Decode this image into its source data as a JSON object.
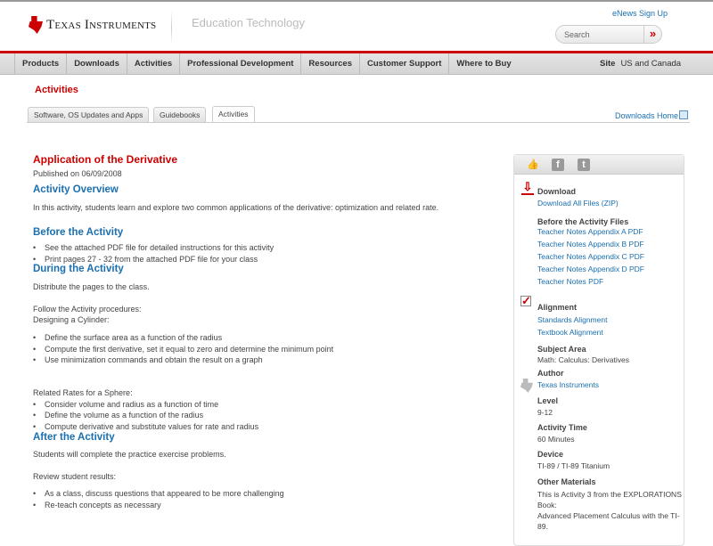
{
  "header": {
    "brand": "Texas Instruments",
    "section": "Education Technology",
    "enews": "eNews Sign Up",
    "search_placeholder": "Search",
    "search_go": "»"
  },
  "nav": {
    "items": [
      "Products",
      "Downloads",
      "Activities",
      "Professional Development",
      "Resources",
      "Customer Support",
      "Where to Buy"
    ],
    "site_label": "Site",
    "site_value": "US and Canada"
  },
  "page_heading": "Activities",
  "tabs": [
    "Software, OS Updates and Apps",
    "Guidebooks",
    "Activities"
  ],
  "downloads_home": "Downloads Home",
  "article": {
    "title": "Application of the Derivative",
    "published": "Published on 06/09/2008",
    "overview_h": "Activity Overview",
    "overview": "In this activity, students learn and explore two common applications of the derivative: optimization and related rate.",
    "before_h": "Before the Activity",
    "before": [
      "See the attached PDF file for detailed instructions for this activity",
      "Print pages 27 - 32 from the attached PDF file for your class"
    ],
    "during_h": "During the Activity",
    "during_p1": "Distribute the pages to the class.",
    "during_p2": "Follow the Activity procedures:",
    "during_p3": "Designing a Cylinder:",
    "during_list1": [
      "Define the surface area as a function of the radius",
      "Compute the first derivative, set it equal to zero and determine the minimum point",
      "Use minimization commands and obtain the result on a graph"
    ],
    "during_p4": "Related Rates for a Sphere:",
    "during_list2": [
      "Consider volume and radius as a function of time",
      "Define the volume as a function of the radius",
      "Compute derivative and substitute values for rate and radius"
    ],
    "after_h": "After the Activity",
    "after_p1": "Students will complete the practice exercise problems.",
    "after_p2": "Review student results:",
    "after_list": [
      "As a class, discuss questions that appeared to be more challenging",
      "Re-teach concepts as necessary"
    ]
  },
  "sidebar": {
    "download_h": "Download",
    "download_all": "Download All Files (ZIP)",
    "before_files_h": "Before the Activity Files",
    "files": [
      "Teacher Notes Appendix A PDF",
      "Teacher Notes Appendix B PDF",
      "Teacher Notes Appendix C PDF",
      "Teacher Notes Appendix D PDF",
      "Teacher Notes PDF"
    ],
    "alignment_h": "Alignment",
    "alignment": [
      "Standards Alignment",
      "Textbook Alignment"
    ],
    "subject_h": "Subject Area",
    "subject": "Math: Calculus: Derivatives",
    "author_h": "Author",
    "author": "Texas Instruments",
    "level_h": "Level",
    "level": "9-12",
    "time_h": "Activity Time",
    "time": "60 Minutes",
    "device_h": "Device",
    "device": "TI-89 / TI-89 Titanium",
    "other_h": "Other Materials",
    "other": [
      "This is Activity 3 from the EXPLORATIONS",
      "Book:",
      "Advanced Placement Calculus with the TI-",
      "89."
    ]
  }
}
